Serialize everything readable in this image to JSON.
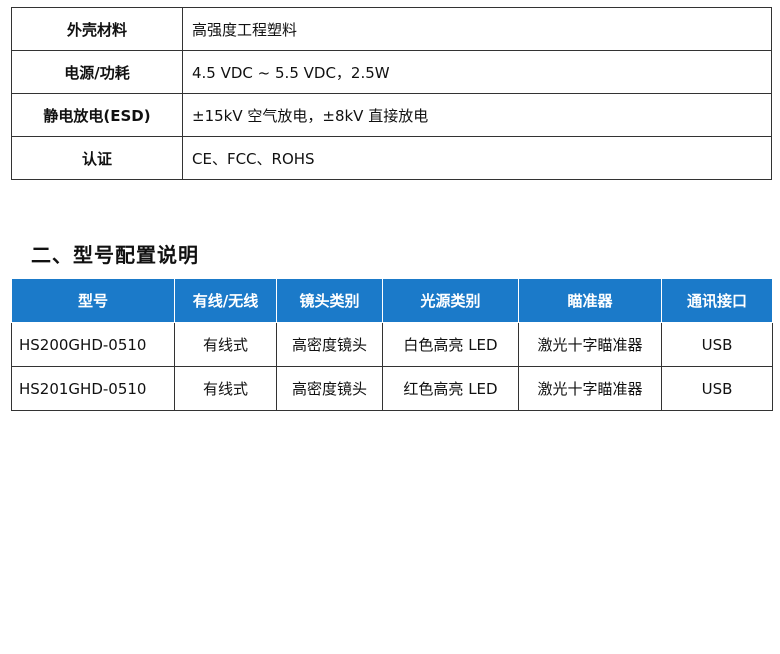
{
  "specs": [
    {
      "label": "外壳材料",
      "value": "高强度工程塑料"
    },
    {
      "label": "电源/功耗",
      "value": "4.5 VDC ~ 5.5 VDC，2.5W"
    },
    {
      "label": "静电放电(ESD)",
      "value": "±15kV 空气放电，±8kV 直接放电"
    },
    {
      "label": "认证",
      "value": "CE、FCC、ROHS"
    }
  ],
  "section": {
    "title": "二、型号配置说明"
  },
  "models": {
    "header_color": "#1b7ac9",
    "headers": [
      "型号",
      "有线/无线",
      "镜头类别",
      "光源类别",
      "瞄准器",
      "通讯接口"
    ],
    "rows": [
      [
        "HS200GHD-0510",
        "有线式",
        "高密度镜头",
        "白色高亮 LED",
        "激光十字瞄准器",
        "USB"
      ],
      [
        "HS201GHD-0510",
        "有线式",
        "高密度镜头",
        "红色高亮 LED",
        "激光十字瞄准器",
        "USB"
      ]
    ]
  }
}
